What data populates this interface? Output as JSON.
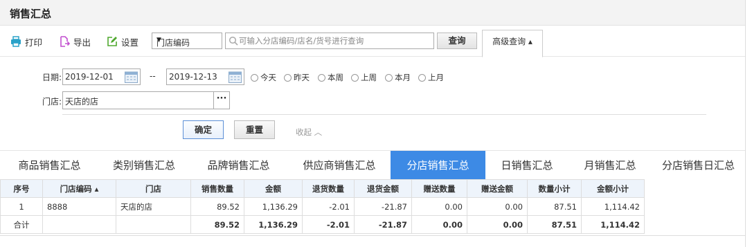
{
  "title": "销售汇总",
  "toolbar": {
    "print": "打印",
    "export": "导出",
    "settings": "设置",
    "field_select": "门店编码",
    "search_placeholder": "可输入分店编码/店名/货号进行查询",
    "query": "查询",
    "advanced": "高级查询 ▴"
  },
  "filter": {
    "date_label": "日期:",
    "date_from": "2019-12-01",
    "date_sep": "--",
    "date_to": "2019-12-13",
    "quick_ranges": [
      "今天",
      "昨天",
      "本周",
      "上周",
      "本月",
      "上月"
    ],
    "store_label": "门店:",
    "store_value": "天店的店",
    "store_more": "···",
    "confirm": "确定",
    "reset": "重置",
    "collapse": "收起 ︿"
  },
  "tabs": [
    "商品销售汇总",
    "类别销售汇总",
    "品牌销售汇总",
    "供应商销售汇总",
    "分店销售汇总",
    "日销售汇总",
    "月销售汇总",
    "分店销售日汇总"
  ],
  "active_tab": 4,
  "accent_color": "#3d8ae5",
  "table": {
    "columns": [
      "序号",
      "门店编码 ▴",
      "门店",
      "销售数量",
      "金额",
      "退货数量",
      "退货金额",
      "赠送数量",
      "赠送金额",
      "数量小计",
      "金额小计"
    ],
    "rows": [
      [
        "1",
        "8888",
        "天店的店",
        "89.52",
        "1,136.29",
        "-2.01",
        "-21.87",
        "0.00",
        "0.00",
        "87.51",
        "1,114.42"
      ]
    ],
    "total": [
      "合计",
      "",
      "",
      "89.52",
      "1,136.29",
      "-2.01",
      "-21.87",
      "0.00",
      "0.00",
      "87.51",
      "1,114.42"
    ]
  }
}
